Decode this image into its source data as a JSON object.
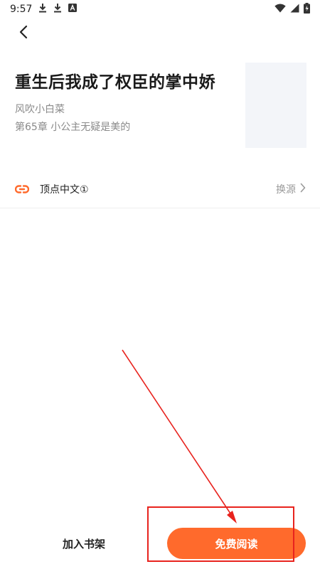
{
  "status_bar": {
    "time": "9:57",
    "icons": [
      "download-icon",
      "download-icon",
      "font-app-icon",
      "wifi-icon",
      "signal-icon",
      "battery-charging-icon"
    ]
  },
  "nav": {
    "back_icon": "chevron-left-icon"
  },
  "book": {
    "title": "重生后我成了权臣的掌中娇",
    "author": "风吹小白菜",
    "chapter": "第65章 小公主无疑是美的"
  },
  "source": {
    "name": "顶点中文①",
    "change_label": "换源",
    "icon_color": "#ff6a2c"
  },
  "actions": {
    "add_shelf_label": "加入书架",
    "read_label": "免费阅读"
  },
  "colors": {
    "accent": "#ff6a2c",
    "annotation": "#e8231e"
  }
}
